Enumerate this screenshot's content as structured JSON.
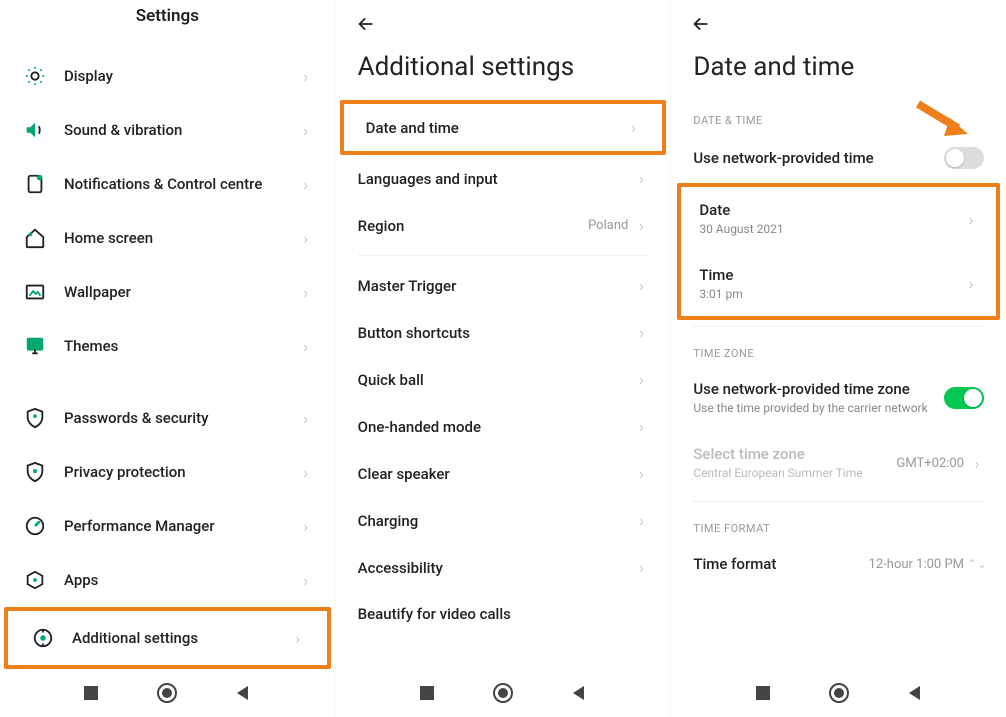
{
  "screen1": {
    "title": "Settings",
    "items": [
      {
        "label": "Display"
      },
      {
        "label": "Sound & vibration"
      },
      {
        "label": "Notifications & Control centre"
      },
      {
        "label": "Home screen"
      },
      {
        "label": "Wallpaper"
      },
      {
        "label": "Themes"
      }
    ],
    "items2": [
      {
        "label": "Passwords & security"
      },
      {
        "label": "Privacy protection"
      },
      {
        "label": "Performance Manager"
      },
      {
        "label": "Apps"
      },
      {
        "label": "Additional settings"
      }
    ]
  },
  "screen2": {
    "title": "Additional settings",
    "group1": [
      {
        "label": "Date and time"
      },
      {
        "label": "Languages and input"
      },
      {
        "label": "Region",
        "value": "Poland"
      }
    ],
    "group2": [
      {
        "label": "Master Trigger"
      },
      {
        "label": "Button shortcuts"
      },
      {
        "label": "Quick ball"
      },
      {
        "label": "One-handed mode"
      },
      {
        "label": "Clear speaker"
      },
      {
        "label": "Charging"
      },
      {
        "label": "Accessibility"
      },
      {
        "label": "Beautify for video calls"
      }
    ]
  },
  "screen3": {
    "title": "Date and time",
    "sec_datetime": "DATE & TIME",
    "use_network_time": "Use network-provided time",
    "date_label": "Date",
    "date_value": "30 August 2021",
    "time_label": "Time",
    "time_value": "3:01 pm",
    "sec_timezone": "TIME ZONE",
    "use_network_tz": "Use network-provided time zone",
    "use_network_tz_sub": "Use the time provided by the carrier network",
    "select_tz": "Select time zone",
    "select_tz_sub": "Central European Summer Time",
    "select_tz_value": "GMT+02:00",
    "sec_format": "TIME FORMAT",
    "time_format": "Time format",
    "time_format_value": "12-hour 1:00 PM"
  }
}
